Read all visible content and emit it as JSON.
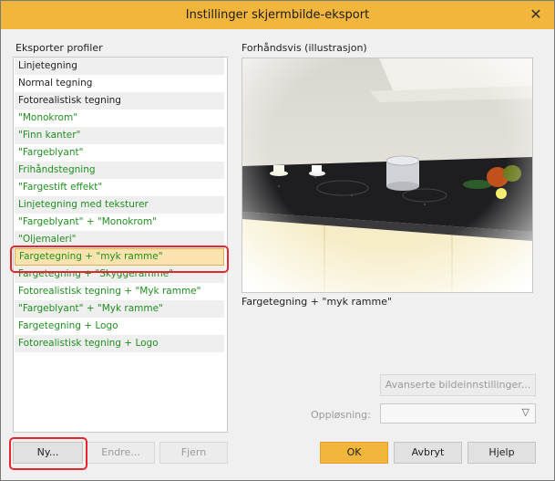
{
  "window": {
    "title": "Instillinger skjermbilde-eksport",
    "close_symbol": "✕"
  },
  "profiles": {
    "label": "Eksporter profiler",
    "items": [
      {
        "label": "Linjetegning",
        "color": "#222222"
      },
      {
        "label": "Normal tegning",
        "color": "#222222"
      },
      {
        "label": "Fotorealistisk tegning",
        "color": "#222222"
      },
      {
        "label": "\"Monokrom\"",
        "color": "#1f8f1f"
      },
      {
        "label": "\"Finn kanter\"",
        "color": "#1f8f1f"
      },
      {
        "label": "\"Fargeblyant\"",
        "color": "#1f8f1f"
      },
      {
        "label": "Frihåndstegning",
        "color": "#1f8f1f"
      },
      {
        "label": "\"Fargestift effekt\"",
        "color": "#1f8f1f"
      },
      {
        "label": "Linjetegning med teksturer",
        "color": "#1f8f1f"
      },
      {
        "label": "\"Fargeblyant\" + \"Monokrom\"",
        "color": "#1f8f1f"
      },
      {
        "label": "\"Oljemaleri\"",
        "color": "#1f8f1f"
      },
      {
        "label": "Fargetegning + \"myk ramme\"",
        "color": "#1f8f1f",
        "selected": true
      },
      {
        "label": "Fargetegning + \"Skyggeramme\"",
        "color": "#1f8f1f"
      },
      {
        "label": "Fotorealistisk tegning + \"Myk ramme\"",
        "color": "#1f8f1f"
      },
      {
        "label": "\"Fargeblyant\" + \"Myk ramme\"",
        "color": "#1f8f1f"
      },
      {
        "label": "Fargetegning + Logo",
        "color": "#1f8f1f"
      },
      {
        "label": "Fotorealistisk tegning + Logo",
        "color": "#1f8f1f"
      }
    ]
  },
  "preview": {
    "label": "Forhåndsvis (illustrasjon)",
    "caption": "Fargetegning + \"myk ramme\""
  },
  "buttons": {
    "new": "Ny...",
    "edit": "Endre...",
    "remove": "Fjern",
    "advanced": "Avanserte bildeinnstillinger...",
    "ok": "OK",
    "cancel": "Avbryt",
    "help": "Hjelp"
  },
  "resolution": {
    "label": "Oppløsning:",
    "value": ""
  },
  "colors": {
    "titlebar": "#f3b63c",
    "selected_item": "#fbe3b0",
    "profile_text_green": "#1f8f1f",
    "highlight_red": "#e3272f"
  }
}
